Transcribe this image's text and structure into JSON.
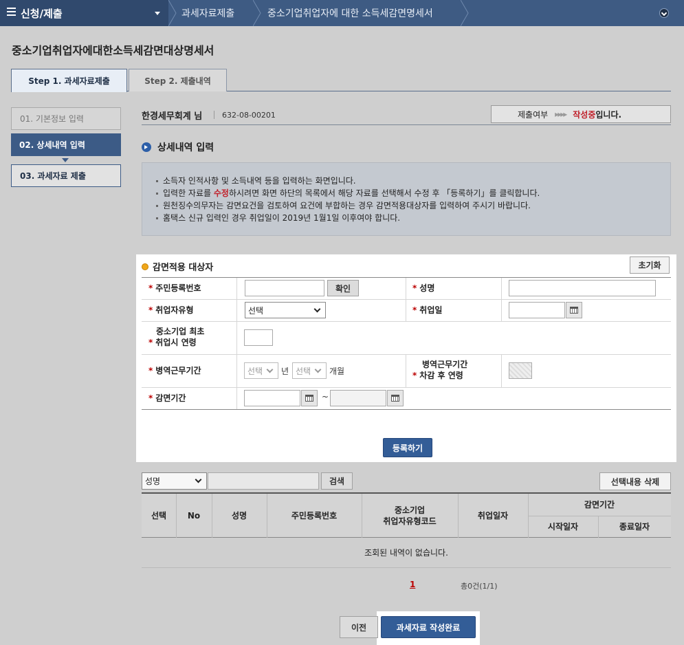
{
  "topbar": {
    "menu_label": "신청/제출",
    "breadcrumbs": [
      "과세자료제출",
      "중소기업취업자에 대한 소득세감면명세서"
    ]
  },
  "page_title": "중소기업취업자에대한소득세감면대상명세서",
  "tabs": [
    {
      "label": "Step 1. 과세자료제출",
      "active": true
    },
    {
      "label": "Step 2. 제출내역",
      "active": false
    }
  ],
  "steps": [
    {
      "label": "01. 기본정보 입력"
    },
    {
      "label": "02. 상세내역 입력"
    },
    {
      "label": "03. 과세자료 제출"
    }
  ],
  "company": {
    "name": "한경세무회계 님",
    "biz_no": "632-08-00201"
  },
  "status": {
    "label": "제출여부",
    "arrows": "▸▸▸▸",
    "value": "작성중",
    "suffix": "입니다."
  },
  "section_title": "상세내역 입력",
  "guide": [
    "소득자 인적사항 및 소득내역 등을 입력하는 화면입니다.",
    {
      "pre": "입력한 자료를 ",
      "red": "수정",
      "post": "하시려면 화면 하단의 목록에서 해당 자료를 선택해서 수정 후 「등록하기」를 클릭합니다."
    },
    "원천징수의무자는 감면요건을 검토하여 요건에 부합하는 경우 감면적용대상자를 입력하여 주시기 바랍니다.",
    "홈택스 신규 입력인 경우 취업일이 2019년 1월1일 이후여야 합니다."
  ],
  "form": {
    "title": "감면적용 대상자",
    "reset_label": "초기화",
    "req_mark": "*",
    "resident_no_label": "주민등록번호",
    "confirm_label": "확인",
    "name_label": "성명",
    "emp_type_label": "취업자유형",
    "emp_type_value": "선택",
    "hire_date_label": "취업일",
    "first_age_label_1": "중소기업 최초",
    "first_age_label_2": "취업시 연령",
    "military_label": "병역근무기간",
    "military_year_value": "선택",
    "year_unit": "년",
    "military_month_value": "선택",
    "month_unit": "개월",
    "age_after_label_1": "병역근무기간",
    "age_after_label_2": "차감 후 연령",
    "period_label": "감면기간",
    "tilde": "~",
    "register_label": "등록하기"
  },
  "list": {
    "search_field": "성명",
    "search_label": "검색",
    "delete_label": "선택내용 삭제",
    "columns": {
      "select": "선택",
      "no": "No",
      "name": "성명",
      "resident_no": "주민등록번호",
      "type_code_1": "중소기업",
      "type_code_2": "취업자유형코드",
      "hire_date": "취업일자",
      "period": "감면기간",
      "start": "시작일자",
      "end": "종료일자"
    },
    "empty_text": "조회된 내역이 없습니다.",
    "page": "1",
    "total": "총0건(1/1)"
  },
  "footer": {
    "prev_label": "이전",
    "complete_label": "과세자료 작성완료"
  }
}
